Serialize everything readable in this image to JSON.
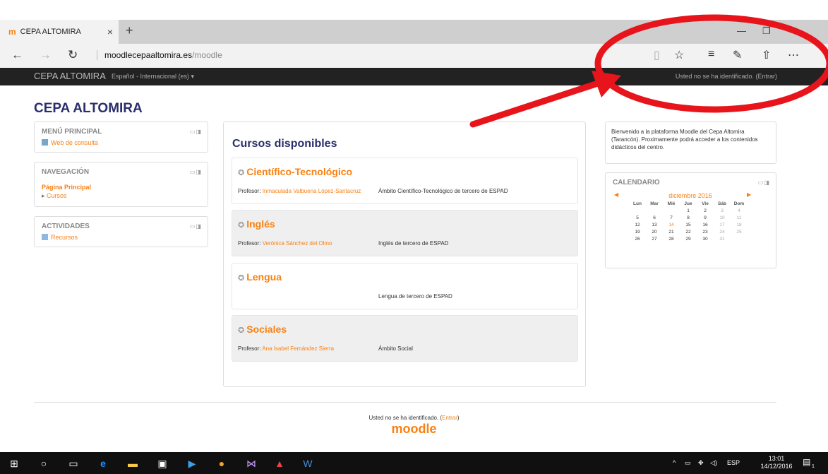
{
  "browser": {
    "tab_title": "CEPA ALTOMIRA",
    "tab_favicon": "m",
    "new_tab": "+",
    "tab_close": "×",
    "url_host": "moodlecepaaltomira.es",
    "url_path": "/moodle"
  },
  "site": {
    "brand": "CEPA ALTOMIRA",
    "language": "Español - Internacional (es) ▾",
    "login_status": "Usted no se ha identificado. (Entrar)",
    "page_title": "CEPA ALTOMIRA"
  },
  "left_blocks": {
    "main_menu": {
      "title": "MENÚ PRINCIPAL",
      "link": "Web de consulta"
    },
    "navigation": {
      "title": "NAVEGACIÓN",
      "home": "Página Principal",
      "courses": "Cursos"
    },
    "activities": {
      "title": "ACTIVIDADES",
      "link": "Recursos"
    }
  },
  "courses_section": {
    "title": "Cursos disponibles",
    "courses": [
      {
        "name": "Científico-Tecnológico",
        "teacher_label": "Profesor:",
        "teacher": "Inmaculada Valbuena López-Santacruz",
        "summary": "Ámbito Científico-Tecnológico de tercero de ESPAD"
      },
      {
        "name": "Inglés",
        "teacher_label": "Profesor:",
        "teacher": "Verónica Sánchez del Olmo",
        "summary": "Inglés de tercero de ESPAD"
      },
      {
        "name": "Lengua",
        "teacher_label": "",
        "teacher": "",
        "summary": "Lengua de tercero de ESPAD"
      },
      {
        "name": "Sociales",
        "teacher_label": "Profesor:",
        "teacher": "Ana Isabel Fernández Sierra",
        "summary": "Ámbito Social"
      }
    ]
  },
  "welcome": "Bienvenido a la plataforma Moodle del Cepa Altomira (Tarancón). Proximamente podrá acceder a los contenidos didácticos del centro.",
  "calendar": {
    "title": "CALENDARIO",
    "month": "diciembre 2016",
    "days_of_week": [
      "Lun",
      "Mar",
      "Mié",
      "Jue",
      "Vie",
      "Sáb",
      "Dom"
    ],
    "leading_blanks": 3,
    "days_in_month": 31,
    "today": 14
  },
  "footer": {
    "status_prefix": "Usted no se ha identificado. (",
    "status_link": "Entrar",
    "status_suffix": ")",
    "logo": "moodle"
  },
  "taskbar": {
    "language": "ESP",
    "time": "13:01",
    "date": "14/12/2016",
    "notification_count": "1"
  },
  "colors": {
    "accent_orange": "#f98012",
    "title_navy": "#2a2e6b",
    "annotation_red": "#e8141b",
    "moodle_bar": "#222222"
  }
}
